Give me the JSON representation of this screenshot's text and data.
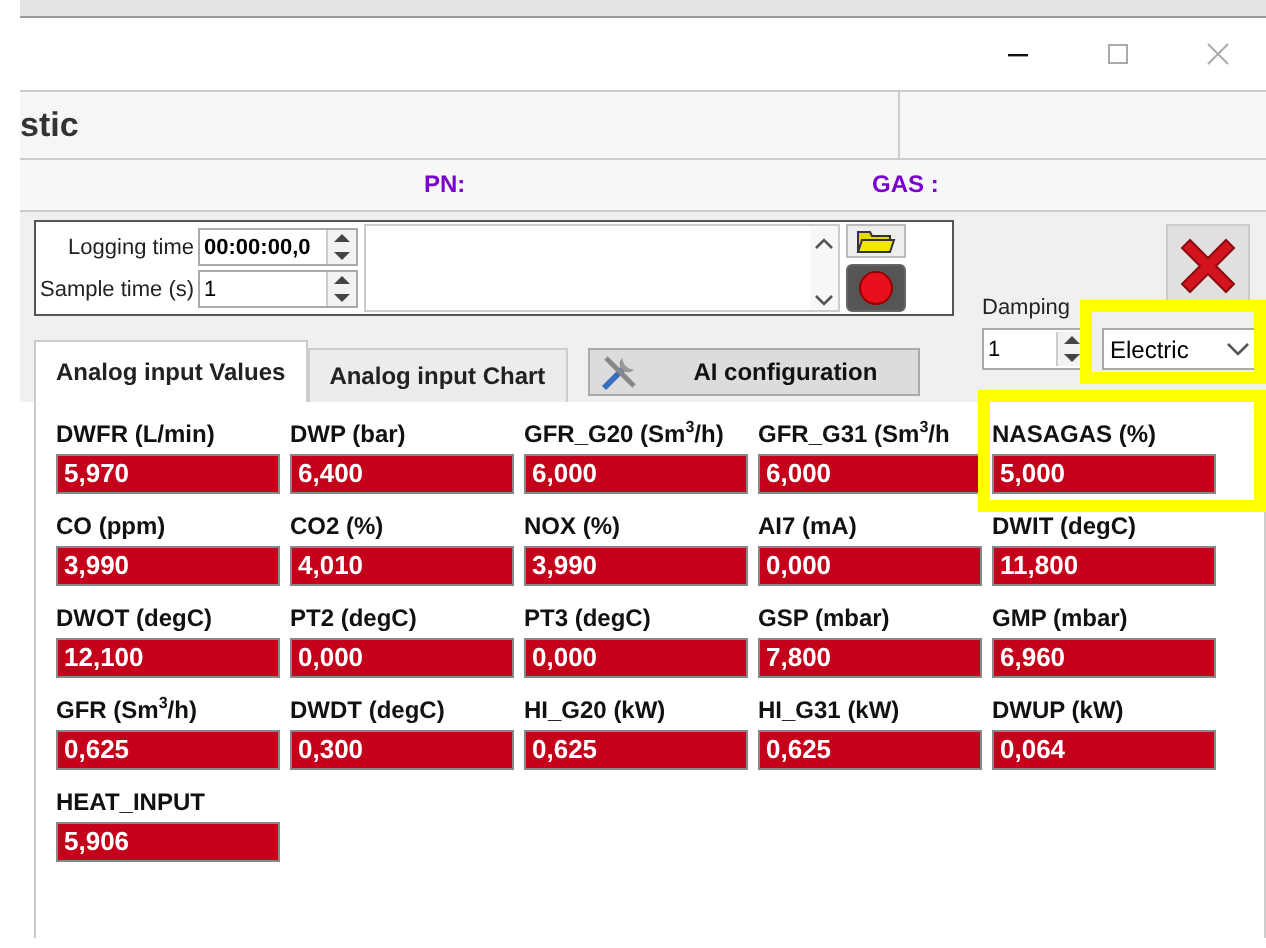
{
  "window": {
    "title": "stic"
  },
  "info_bar": {
    "pn_label": "PN:",
    "gas_label": "GAS :"
  },
  "logging": {
    "logging_time_label": "Logging time",
    "logging_time": "00:00:00,0",
    "sample_time_label": "Sample time (s)",
    "sample_time": "1"
  },
  "damping": {
    "label": "Damping",
    "value": "1"
  },
  "mode_select": {
    "value": "Electric"
  },
  "tabs": [
    {
      "label": "Analog input Values",
      "selected": true
    },
    {
      "label": "Analog input Chart",
      "selected": false
    }
  ],
  "config_button": {
    "label": "AI configuration"
  },
  "readings": [
    {
      "label": "DWFR  (L/min)",
      "value": "5,970"
    },
    {
      "label": "DWP  (bar)",
      "value": "6,400"
    },
    {
      "label": "GFR_G20  (Sm$^{3}$/h)",
      "value": "6,000"
    },
    {
      "label": "GFR_G31  (Sm$^{3}$/h",
      "value": "6,000"
    },
    {
      "label": "NASAGAS  (%)",
      "value": "5,000"
    },
    {
      "label": "CO  (ppm)",
      "value": "3,990"
    },
    {
      "label": "CO2  (%)",
      "value": "4,010"
    },
    {
      "label": "NOX  (%)",
      "value": "3,990"
    },
    {
      "label": "AI7  (mA)",
      "value": "0,000"
    },
    {
      "label": "DWIT  (degC)",
      "value": "11,800"
    },
    {
      "label": "DWOT  (degC)",
      "value": "12,100"
    },
    {
      "label": "PT2  (degC)",
      "value": "0,000"
    },
    {
      "label": "PT3  (degC)",
      "value": "0,000"
    },
    {
      "label": "GSP  (mbar)",
      "value": "7,800"
    },
    {
      "label": "GMP  (mbar)",
      "value": "6,960"
    },
    {
      "label": "GFR  (Sm$^{3}$/h)",
      "value": "0,625"
    },
    {
      "label": "DWDT  (degC)",
      "value": "0,300"
    },
    {
      "label": "HI_G20  (kW)",
      "value": "0,625"
    },
    {
      "label": "HI_G31  (kW)",
      "value": "0,625"
    },
    {
      "label": "DWUP  (kW)",
      "value": "0,064"
    },
    {
      "label": "HEAT_INPUT",
      "value": "5,906"
    }
  ]
}
